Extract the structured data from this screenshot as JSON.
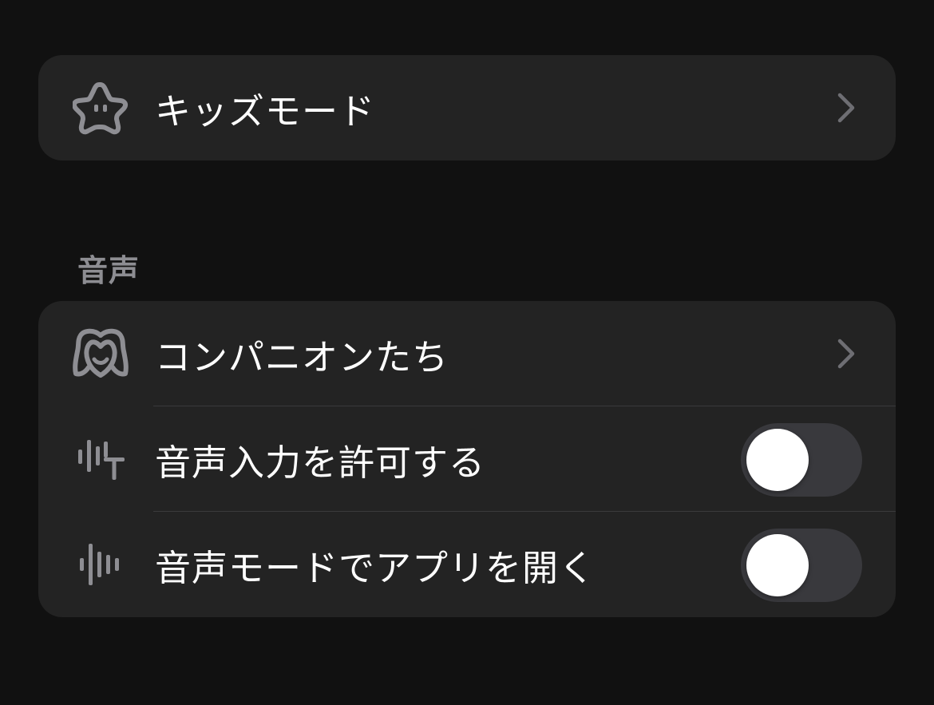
{
  "kids_section": {
    "items": [
      {
        "label": "キッズモード",
        "icon": "star-face-icon"
      }
    ]
  },
  "voice_section": {
    "header": "音声",
    "items": [
      {
        "label": "コンパニオンたち",
        "icon": "companion-face-icon",
        "type": "link"
      },
      {
        "label": "音声入力を許可する",
        "icon": "voice-input-waveform-icon",
        "type": "toggle",
        "value": false
      },
      {
        "label": "音声モードでアプリを開く",
        "icon": "voice-mode-waveform-icon",
        "type": "toggle",
        "value": false
      }
    ]
  },
  "colors": {
    "background": "#111111",
    "card": "#232323",
    "icon": "#8e8e93",
    "toggle_off": "#39393d",
    "section_header": "#8d8d92"
  }
}
